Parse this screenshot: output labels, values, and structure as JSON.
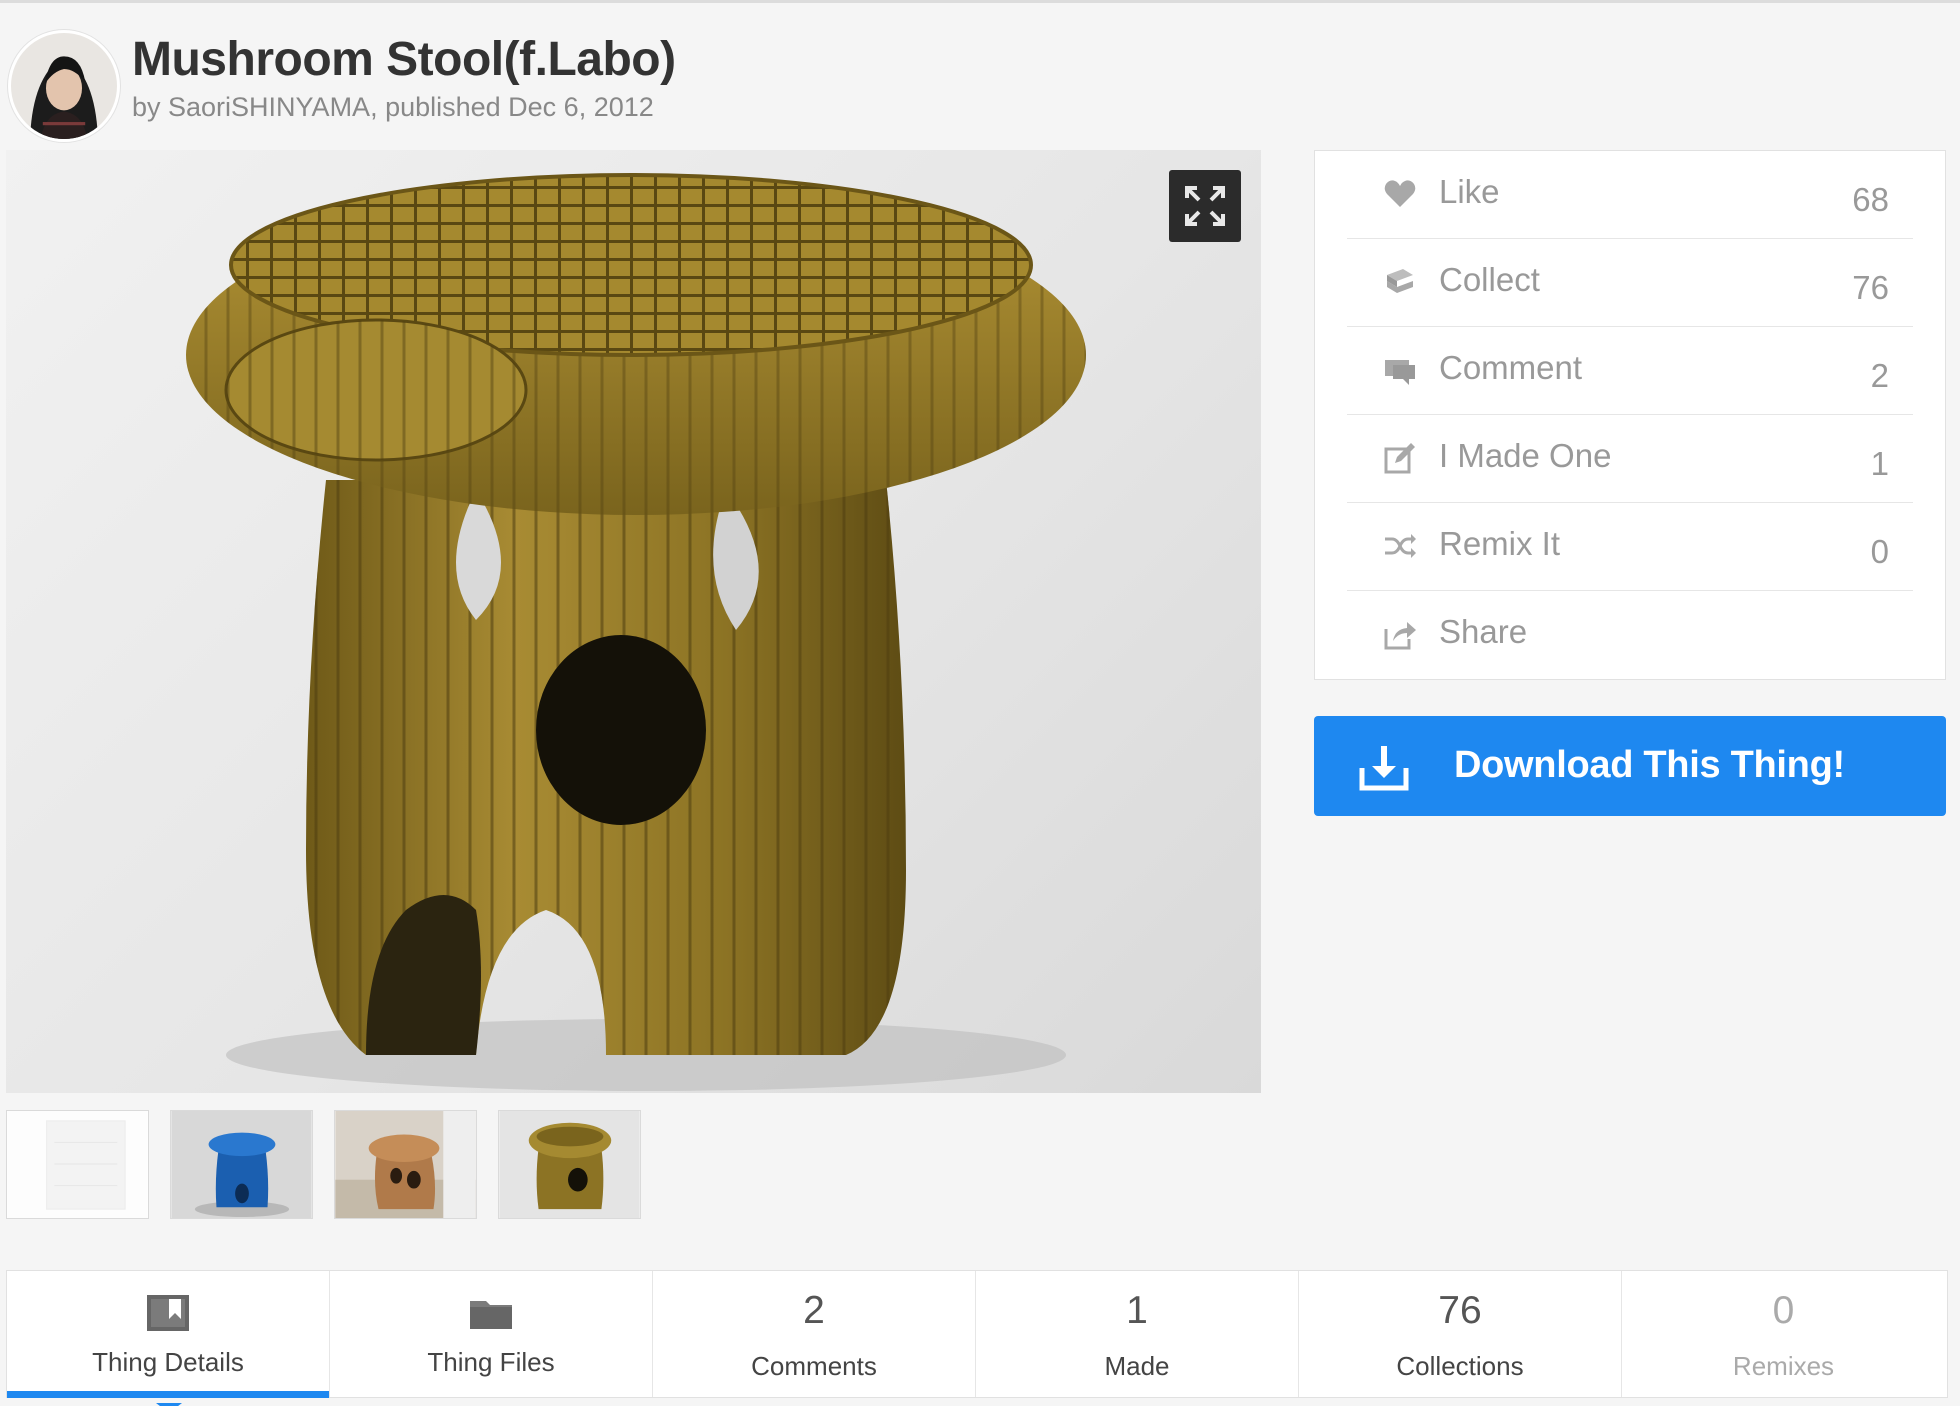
{
  "thing": {
    "title": "Mushroom Stool(f.Labo)",
    "byline": "by SaoriSHINYAMA, published Dec 6, 2012"
  },
  "icons": {
    "expand": "expand-arrows-icon",
    "like": "heart-icon",
    "collect": "stack-icon",
    "comment": "speech-bubble-icon",
    "made": "pencil-square-icon",
    "remix": "shuffle-icon",
    "share": "share-arrow-icon",
    "download": "download-tray-icon",
    "details": "bookmark-icon",
    "files": "folder-icon"
  },
  "actions": [
    {
      "label": "Like",
      "count": "68"
    },
    {
      "label": "Collect",
      "count": "76"
    },
    {
      "label": "Comment",
      "count": "2"
    },
    {
      "label": "I Made One",
      "count": "1"
    },
    {
      "label": "Remix It",
      "count": "0"
    },
    {
      "label": "Share",
      "count": ""
    }
  ],
  "download": {
    "label": "Download This Thing!"
  },
  "tabs": {
    "details": {
      "label": "Thing Details"
    },
    "files": {
      "label": "Thing Files"
    },
    "comments": {
      "num": "2",
      "label": "Comments"
    },
    "made": {
      "num": "1",
      "label": "Made"
    },
    "collections": {
      "num": "76",
      "label": "Collections"
    },
    "remixes": {
      "num": "0",
      "label": "Remixes"
    }
  },
  "colors": {
    "accent": "#1e88f0",
    "stool_wood": "#8c7324",
    "muted_text": "#999999"
  }
}
